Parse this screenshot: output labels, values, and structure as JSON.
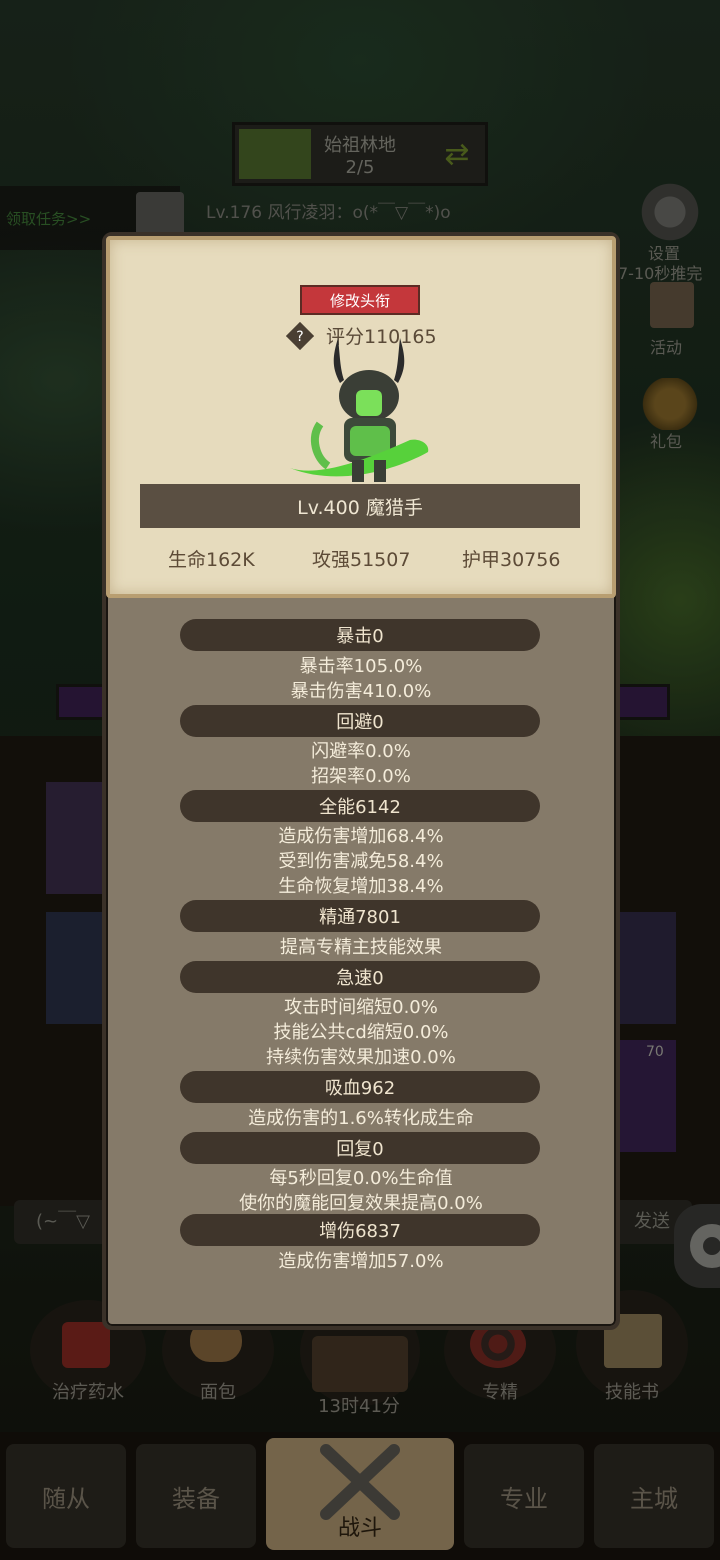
{
  "top": {
    "zone_name": "始祖林地",
    "zone_progress": "2/5",
    "quest_label": "领取任务>>",
    "chat_line": "Lv.176 风行凌羽：o(*￣▽￣*)o"
  },
  "side_menu": [
    {
      "label": "设置",
      "icon": "gear-icon"
    },
    {
      "label": "活动",
      "icon": "scroll-icon"
    },
    {
      "label": "礼包",
      "icon": "coin-icon"
    }
  ],
  "side_notice": "7-10秒推完",
  "profile": {
    "rename_button": "修改头衔",
    "score": "评分110165",
    "level_title": "Lv.400 魔猎手",
    "hp": "生命162K",
    "attack": "攻强51507",
    "armor": "护甲30756"
  },
  "stats": [
    {
      "header": "暴击0",
      "lines": [
        "暴击率105.0%",
        "暴击伤害410.0%"
      ]
    },
    {
      "header": "回避0",
      "lines": [
        "闪避率0.0%",
        "招架率0.0%"
      ]
    },
    {
      "header": "全能6142",
      "lines": [
        "造成伤害增加68.4%",
        "受到伤害减免58.4%",
        "生命恢复增加38.4%"
      ]
    },
    {
      "header": "精通7801",
      "lines": [
        "提高专精主技能效果"
      ]
    },
    {
      "header": "急速0",
      "lines": [
        "攻击时间缩短0.0%",
        "技能公共cd缩短0.0%",
        "持续伤害效果加速0.0%"
      ]
    },
    {
      "header": "吸血962",
      "lines": [
        "造成伤害的1.6%转化成生命"
      ]
    },
    {
      "header": "回复0",
      "lines": [
        "每5秒回复0.0%生命值",
        "使你的魔能回复效果提高0.0%"
      ]
    },
    {
      "header": "增伤6837",
      "lines": [
        "造成伤害增加57.0%"
      ]
    }
  ],
  "background_bits": {
    "item_count": "70",
    "chat_input": "(~￣▽",
    "send_label": "发送"
  },
  "tools": [
    {
      "label": "治疗药水",
      "icon": "potion-icon"
    },
    {
      "label": "面包",
      "icon": "bread-icon"
    },
    {
      "label": "13时41分",
      "icon": "chest-icon"
    },
    {
      "label": "专精",
      "icon": "target-icon"
    },
    {
      "label": "技能书",
      "icon": "book-icon"
    }
  ],
  "nav": [
    {
      "label": "随从"
    },
    {
      "label": "装备"
    },
    {
      "label": "战斗",
      "icon": "crossed-swords-icon"
    },
    {
      "label": "专业"
    },
    {
      "label": "主城"
    }
  ],
  "colors": {
    "panel_bg": "#857a69",
    "card_bg": "#e6dbbd",
    "header_bg": "#3f352b",
    "rename_red": "#c4373b"
  }
}
